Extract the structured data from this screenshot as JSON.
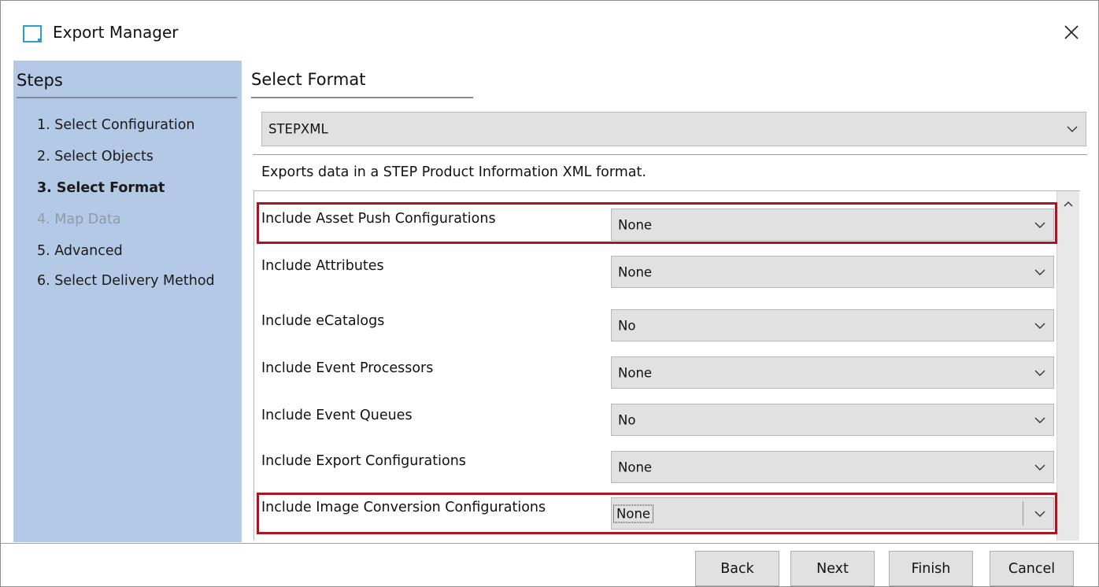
{
  "window": {
    "title": "Export Manager"
  },
  "sidebar": {
    "heading": "Steps",
    "items": [
      {
        "label": "1. Select Configuration",
        "state": "normal"
      },
      {
        "label": "2. Select Objects",
        "state": "normal"
      },
      {
        "label": "3. Select Format",
        "state": "active"
      },
      {
        "label": "4. Map Data",
        "state": "disabled"
      },
      {
        "label": "5. Advanced",
        "state": "normal"
      },
      {
        "label": "6. Select Delivery Method",
        "state": "normal"
      }
    ]
  },
  "main": {
    "heading": "Select Format",
    "format_select": {
      "value": "STEPXML"
    },
    "description": "Exports data in a STEP Product Information XML format.",
    "options": [
      {
        "label": "Include Asset Push Configurations",
        "value": "None",
        "highlighted": true
      },
      {
        "label": "Include Attributes",
        "value": "None",
        "highlighted": false
      },
      {
        "label": "Include eCatalogs",
        "value": "No",
        "highlighted": false
      },
      {
        "label": "Include Event Processors",
        "value": "None",
        "highlighted": false
      },
      {
        "label": "Include Event Queues",
        "value": "No",
        "highlighted": false
      },
      {
        "label": "Include Export Configurations",
        "value": "None",
        "highlighted": false
      },
      {
        "label": "Include Image Conversion Configurations",
        "value": "None",
        "highlighted": true
      }
    ]
  },
  "footer": {
    "back_label": "Back",
    "next_label": "Next",
    "finish_label": "Finish",
    "cancel_label": "Cancel"
  },
  "colors": {
    "sidebar_bg": "#b4c9e6",
    "highlight": "#a8171f",
    "icon_accent": "#2a9fd0",
    "disabled_text": "#8e9aa8"
  },
  "icons": {
    "app": "export-manager-icon",
    "close": "close-icon",
    "dropdown": "chevron-down-icon",
    "scroll_up": "chevron-up-icon"
  }
}
